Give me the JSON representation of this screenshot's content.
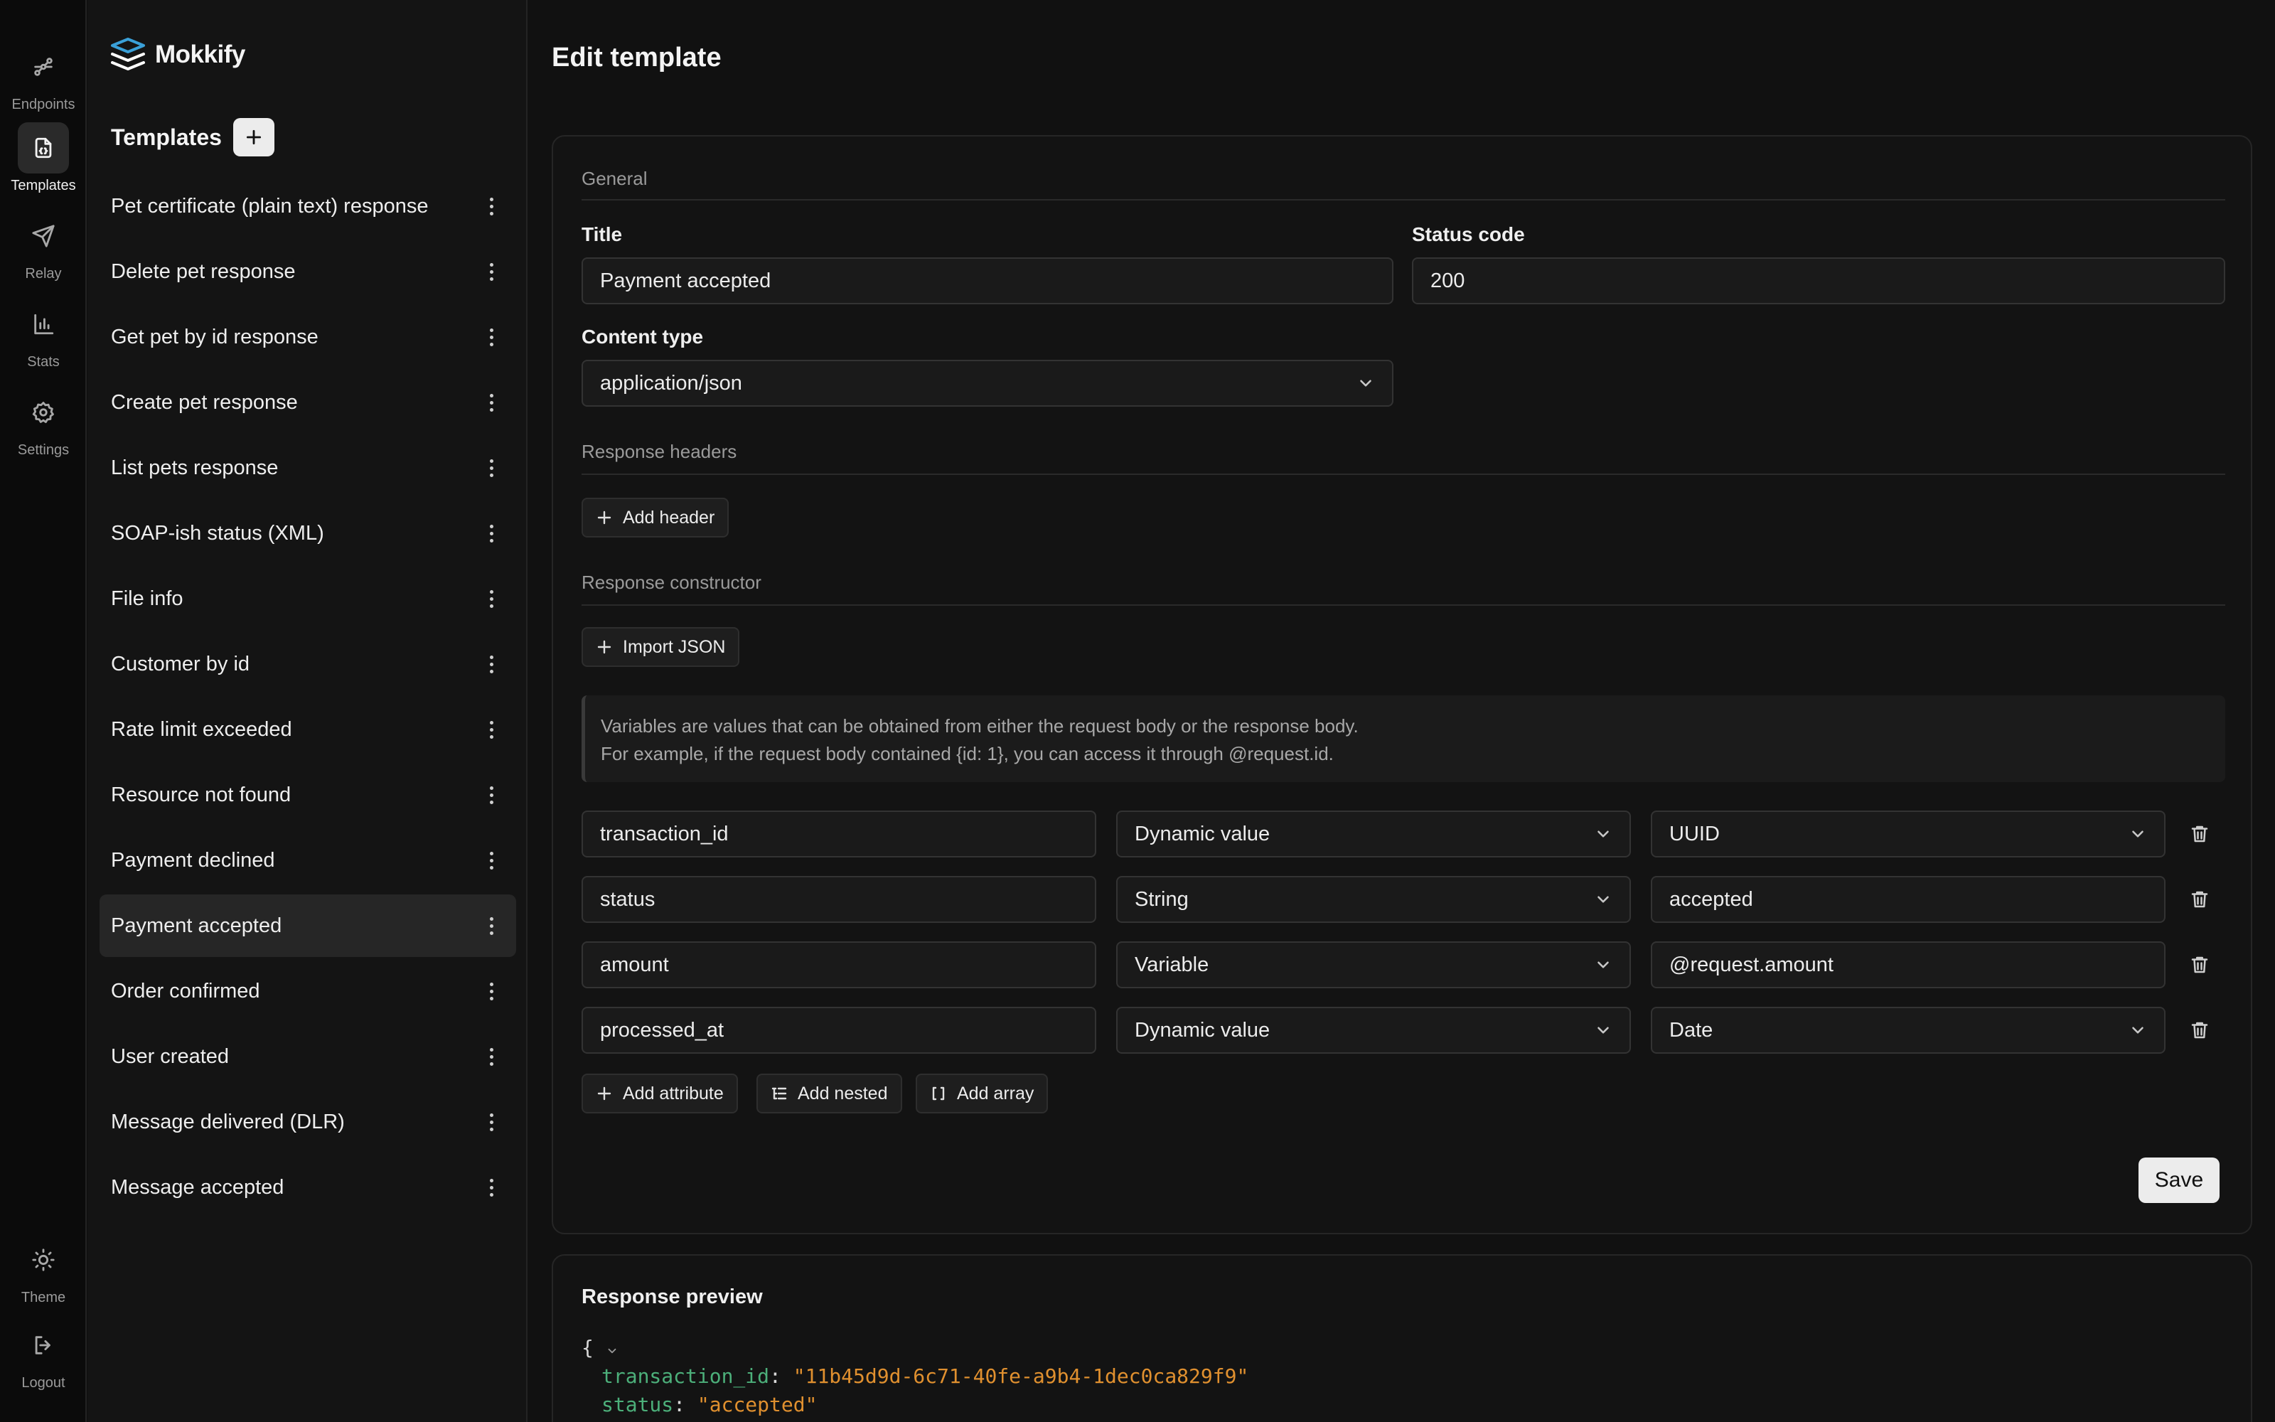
{
  "brand": {
    "name": "Mokkify"
  },
  "rail": {
    "items": [
      {
        "label": "Endpoints"
      },
      {
        "label": "Templates"
      },
      {
        "label": "Relay"
      },
      {
        "label": "Stats"
      },
      {
        "label": "Settings"
      }
    ],
    "bottom": [
      {
        "label": "Theme"
      },
      {
        "label": "Logout"
      }
    ]
  },
  "sidebar": {
    "title": "Templates",
    "add_icon": "plus-icon",
    "items": [
      {
        "label": "Pet certificate (plain text) response"
      },
      {
        "label": "Delete pet response"
      },
      {
        "label": "Get pet by id response"
      },
      {
        "label": "Create pet response"
      },
      {
        "label": "List pets response"
      },
      {
        "label": "SOAP-ish status (XML)"
      },
      {
        "label": "File info"
      },
      {
        "label": "Customer by id"
      },
      {
        "label": "Rate limit exceeded"
      },
      {
        "label": "Resource not found"
      },
      {
        "label": "Payment declined"
      },
      {
        "label": "Payment accepted",
        "active": true
      },
      {
        "label": "Order confirmed"
      },
      {
        "label": "User created"
      },
      {
        "label": "Message delivered (DLR)"
      },
      {
        "label": "Message accepted"
      }
    ]
  },
  "main": {
    "title": "Edit template",
    "general": {
      "section": "General",
      "title_label": "Title",
      "title_value": "Payment accepted",
      "status_label": "Status code",
      "status_value": "200",
      "content_type_label": "Content type",
      "content_type_value": "application/json"
    },
    "headers": {
      "section": "Response headers",
      "add_label": "Add header"
    },
    "constructor": {
      "section": "Response constructor",
      "import_label": "Import JSON",
      "info_line1": "Variables are values that can be obtained from either the request body or the response body.",
      "info_line2": "For example, if the request body contained {id: 1}, you can access it through @request.id.",
      "rows": [
        {
          "name": "transaction_id",
          "type": "Dynamic value",
          "value": "UUID",
          "value_is_select": true
        },
        {
          "name": "status",
          "type": "String",
          "value": "accepted",
          "value_is_select": false
        },
        {
          "name": "amount",
          "type": "Variable",
          "value": "@request.amount",
          "value_is_select": false
        },
        {
          "name": "processed_at",
          "type": "Dynamic value",
          "value": "Date",
          "value_is_select": true
        }
      ],
      "add_attribute": "Add attribute",
      "add_nested": "Add nested",
      "add_array": "Add array"
    },
    "save_label": "Save",
    "preview": {
      "title": "Response preview",
      "open_brace": "{",
      "lines": [
        {
          "key": "transaction_id",
          "value": "\"11b45d9d-6c71-40fe-a9b4-1dec0ca829f9\""
        },
        {
          "key": "status",
          "value": "\"accepted\""
        }
      ]
    }
  },
  "colors": {
    "background": "#111111",
    "sidebar": "#141414",
    "accent_logo": "#3aa0d8",
    "json_key": "#4caf7a",
    "json_string": "#e0902f"
  }
}
